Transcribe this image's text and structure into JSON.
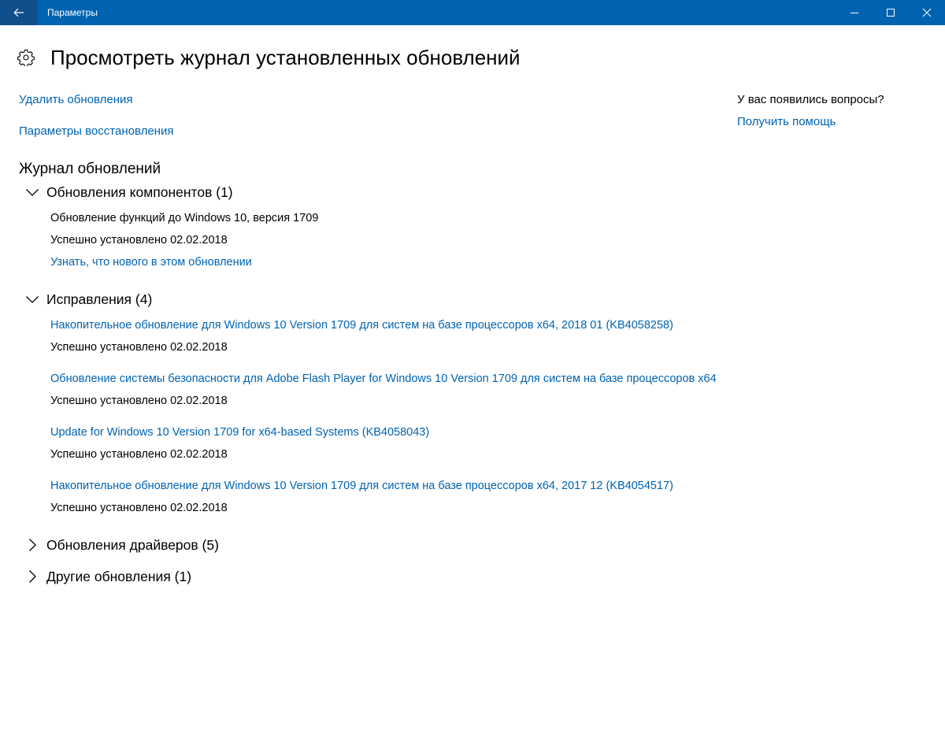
{
  "window": {
    "title": "Параметры",
    "accent": "#0063b1",
    "back_bg": "#0f4f8b"
  },
  "page": {
    "title": "Просмотреть журнал установленных обновлений",
    "icon": "gear-icon"
  },
  "links": {
    "uninstall": "Удалить обновления",
    "recovery": "Параметры восстановления"
  },
  "help": {
    "question": "У вас появились вопросы?",
    "get_help": "Получить помощь"
  },
  "history": {
    "title": "Журнал обновлений",
    "groups": [
      {
        "label": "Обновления компонентов (1)",
        "expanded": true,
        "items": [
          {
            "name": "Обновление функций до Windows 10, версия 1709",
            "status": "Успешно установлено 02.02.2018",
            "link": "Узнать, что нового в этом обновлении"
          }
        ]
      },
      {
        "label": "Исправления (4)",
        "expanded": true,
        "items": [
          {
            "name": "Накопительное обновление для Windows 10 Version 1709 для систем на базе процессоров x64, 2018 01 (KB4058258)",
            "status": "Успешно установлено 02.02.2018"
          },
          {
            "name": "Обновление системы безопасности для Adobe Flash Player for Windows 10 Version 1709 для систем на базе процессоров x64",
            "status": "Успешно установлено 02.02.2018"
          },
          {
            "name": "Update for Windows 10 Version 1709 for x64-based Systems (KB4058043)",
            "status": "Успешно установлено 02.02.2018"
          },
          {
            "name": "Накопительное обновление для Windows 10 Version 1709 для систем на базе процессоров x64, 2017 12 (KB4054517)",
            "status": "Успешно установлено 02.02.2018"
          }
        ]
      },
      {
        "label": "Обновления драйверов (5)",
        "expanded": false
      },
      {
        "label": "Другие обновления (1)",
        "expanded": false
      }
    ]
  }
}
